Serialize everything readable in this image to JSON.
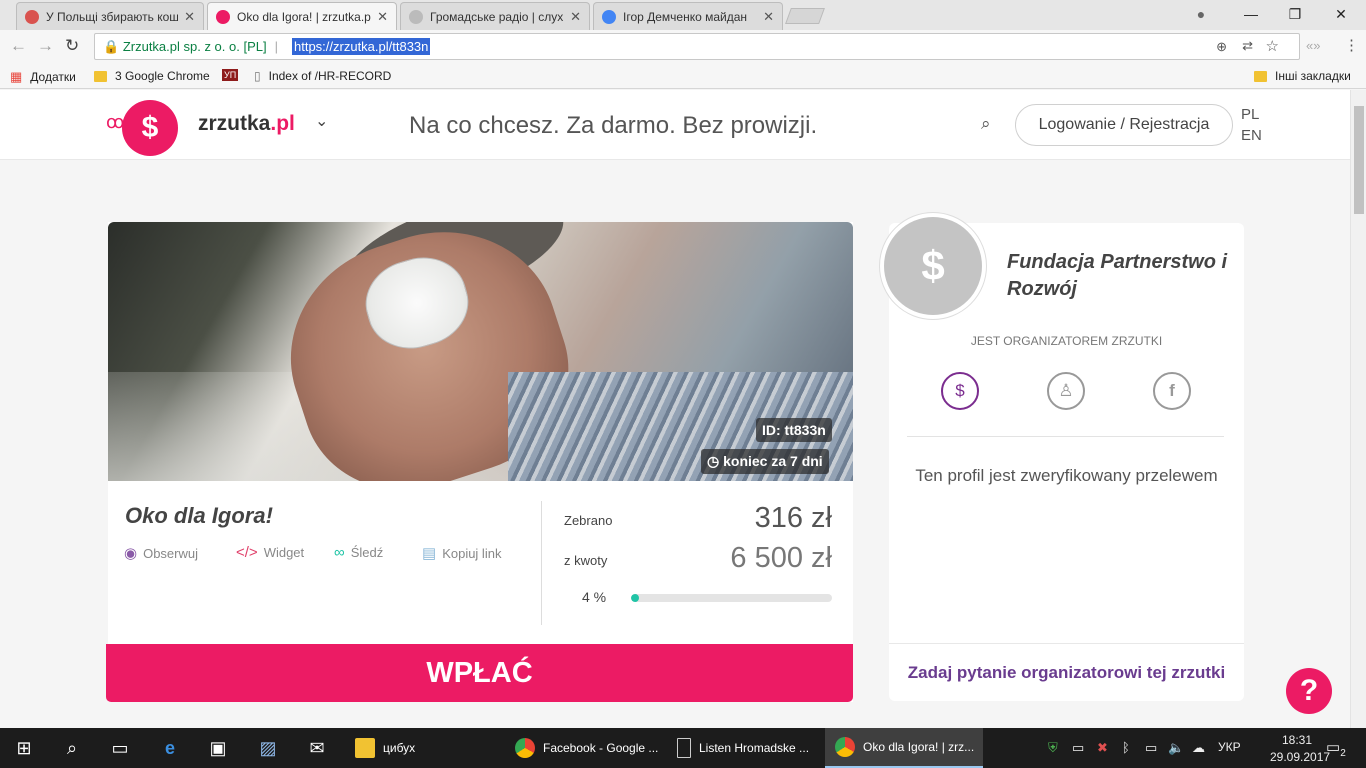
{
  "tabs": [
    {
      "label": "У Польщі збирають кош",
      "active": false
    },
    {
      "label": "Oko dla Igora! | zrzutka.p",
      "active": true
    },
    {
      "label": "Громадське радіо | слух",
      "active": false
    },
    {
      "label": "Ігор Демченко майдан",
      "active": false
    }
  ],
  "window": {
    "minimize": "—",
    "restore": "❐",
    "close": "✕",
    "profile": "●"
  },
  "address": {
    "site_identity": "Zrzutka.pl sp. z o. o. [PL]",
    "url": "https://zrzutka.pl/tt833n"
  },
  "bookmarks": [
    "Додатки",
    "3 Google Chrome",
    "УП",
    "Index of /HR-RECORD",
    "Інші закладки"
  ],
  "site": {
    "logo_text_a": "zrzutka",
    "logo_text_b": ".pl",
    "tagline": "Na co chcesz. Za darmo. Bez prowizji.",
    "login": "Logowanie / Rejestracja",
    "lang_pl": "PL",
    "lang_en": "EN"
  },
  "campaign": {
    "id_badge": "ID: tt833n",
    "end_badge": "koniec za 7 dni",
    "title": "Oko dla Igora!",
    "actions": [
      "Obserwuj",
      "Widget",
      "Śledź",
      "Kopiuj link"
    ],
    "collected_label": "Zebrano",
    "collected_value": "316 zł",
    "goal_label": "z kwoty",
    "goal_value": "6 500 zł",
    "progress_text": "4 %",
    "progress_percent": 4,
    "pay_button": "WPŁAĆ"
  },
  "organizer": {
    "name": "Fundacja Partnerstwo i Rozwój",
    "role": "JEST ORGANIZATOREM ZRZUTKI",
    "verified_text": "Ten profil jest zweryfikowany przelewem",
    "ask_link": "Zadaj pytanie organizatorowi tej zrzutki",
    "help": "?"
  },
  "taskbar": {
    "apps": [
      "цибух",
      "Facebook - Google ...",
      "Listen Hromadske ...",
      "Oko dla Igora! | zrz..."
    ],
    "lang": "УКР",
    "time": "18:31",
    "date": "29.09.2017",
    "notifications": "2"
  },
  "colors": {
    "brand_pink": "#ec1b64",
    "organizer_purple": "#7b2d8f",
    "progress_teal": "#20c4a6"
  }
}
